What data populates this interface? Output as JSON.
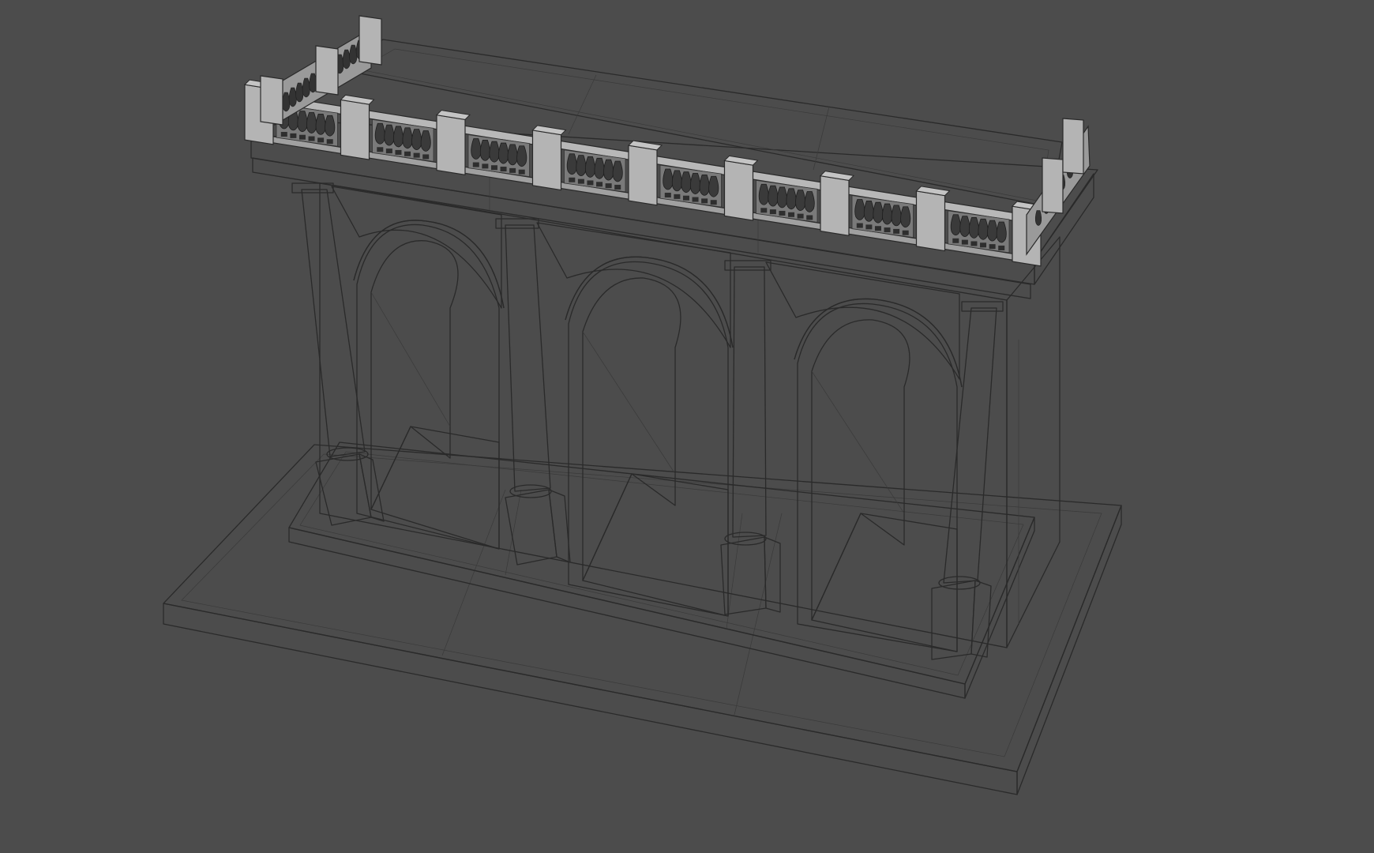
{
  "viewport": {
    "mode": "wireframe-on-shaded",
    "background_color": "#4c4c4c",
    "model_surface_color": "#9a9a9a",
    "wire_color": "#2a2a2a"
  },
  "model": {
    "subject": "arcade-with-balustrade",
    "arch_count": 3,
    "column_count": 4,
    "baluster_panels_front": 8,
    "balusters_per_panel": 6
  }
}
